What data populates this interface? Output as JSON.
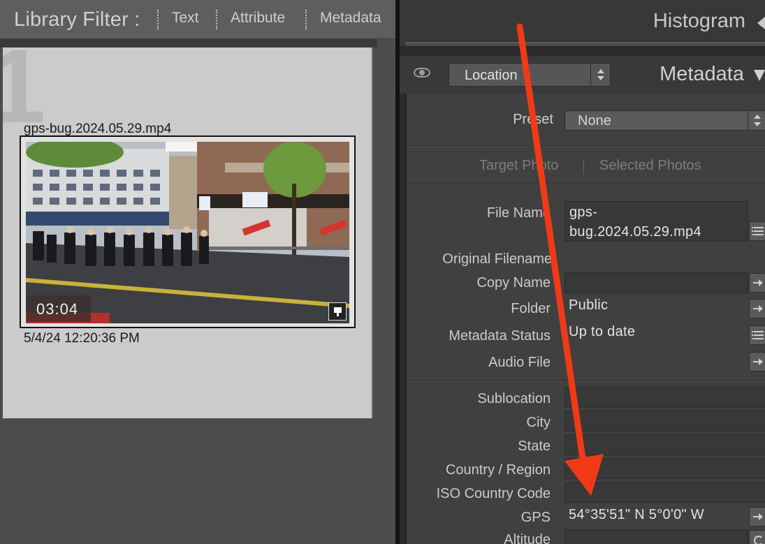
{
  "library_filter": {
    "title": "Library Filter :",
    "options": [
      "Text",
      "Attribute",
      "Metadata"
    ]
  },
  "grid": {
    "cell": {
      "index": "1",
      "filename": "gps-bug.2024.05.29.mp4",
      "duration": "03:04",
      "date": "5/4/24 12:20:36 PM"
    }
  },
  "histogram_panel": {
    "title": "Histogram"
  },
  "metadata_panel": {
    "title": "Metadata",
    "preset_selector": "Location",
    "preset": {
      "label": "Preset",
      "value": "None"
    },
    "tabs": [
      "Target Photo",
      "Selected Photos"
    ],
    "fields": [
      {
        "label": "File Name",
        "value": "gps-\nbug.2024.05.29.mp4",
        "action": "list-icon"
      },
      {
        "label": "Original Filename",
        "value": "",
        "action": ""
      },
      {
        "label": "Copy Name",
        "value": "",
        "action": "arrow-right-icon"
      },
      {
        "label": "Folder",
        "value": "Public",
        "action": "arrow-right-icon"
      },
      {
        "label": "Metadata Status",
        "value": "Up to date",
        "action": "list-icon"
      },
      {
        "label": "Audio File",
        "value": "",
        "action": "arrow-right-icon"
      },
      {
        "label": "Sublocation",
        "value": "",
        "action": ""
      },
      {
        "label": "City",
        "value": "",
        "action": ""
      },
      {
        "label": "State",
        "value": "",
        "action": ""
      },
      {
        "label": "Country / Region",
        "value": "",
        "action": ""
      },
      {
        "label": "ISO Country Code",
        "value": "",
        "action": ""
      },
      {
        "label": "GPS",
        "value": "54°35'51\" N 5°0'0\" W",
        "action": "arrow-right-icon"
      },
      {
        "label": "Altitude",
        "value": "",
        "action": "refresh-icon"
      }
    ]
  },
  "colors": {
    "annotation_arrow": "#f03a17",
    "panel_bg": "#404040",
    "grid_cell_bg": "#cbcbcb"
  }
}
